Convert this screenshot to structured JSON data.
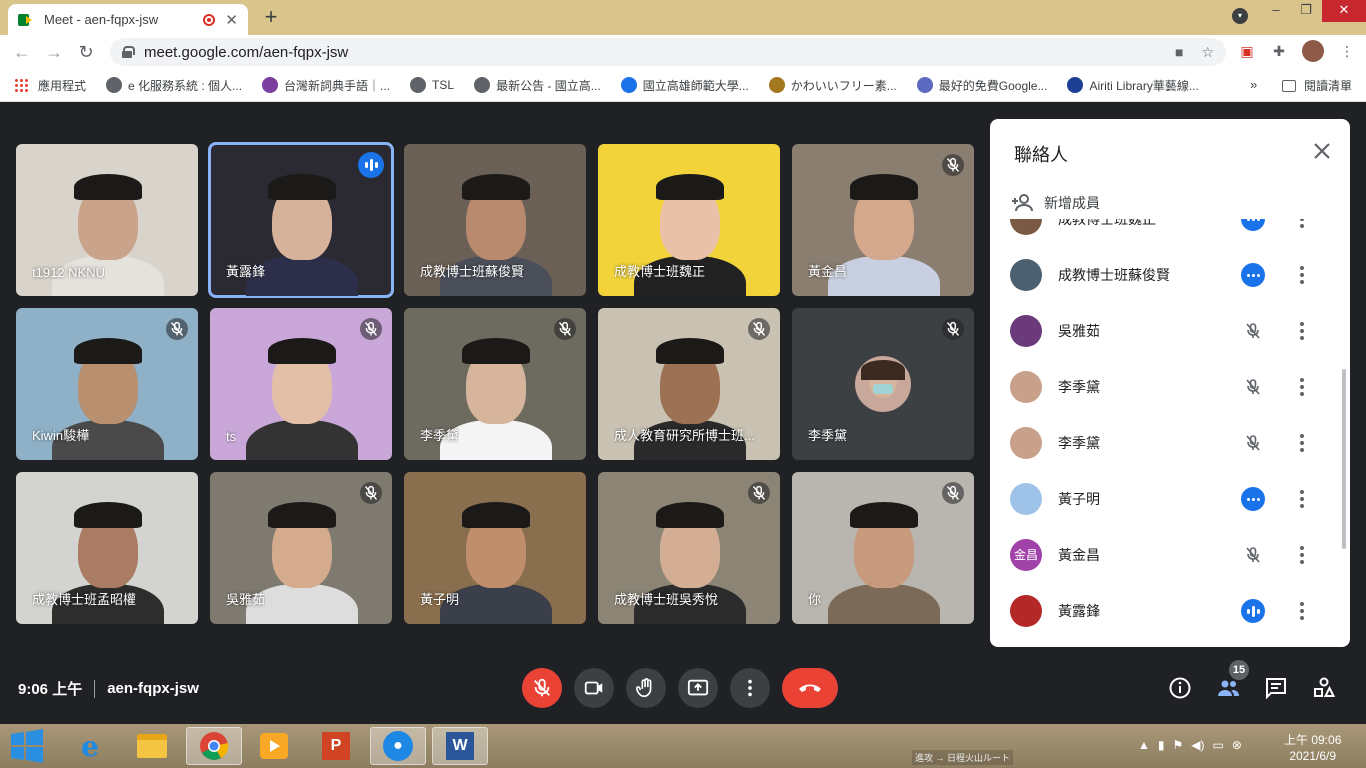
{
  "browser": {
    "tab_title": "Meet - aen-fqpx-jsw",
    "url": "meet.google.com/aen-fqpx-jsw",
    "window_controls": [
      "⌄",
      "–",
      "❐",
      "✕"
    ]
  },
  "bookmarks": {
    "items": [
      {
        "label": "應用程式",
        "icon": "apps-grid-icon",
        "color": "#ea4335"
      },
      {
        "label": "e 化服務系統 : 個人...",
        "icon": "globe-icon",
        "color": "#5f6368"
      },
      {
        "label": "台灣新詞典手語｜...",
        "icon": "site-icon",
        "color": "#7b3fa0"
      },
      {
        "label": "TSL",
        "icon": "globe-icon",
        "color": "#5f6368"
      },
      {
        "label": "最新公告 - 國立高...",
        "icon": "globe-icon",
        "color": "#5f6368"
      },
      {
        "label": "國立高雄師範大學...",
        "icon": "site-icon",
        "color": "#1a73e8"
      },
      {
        "label": "かわいいフリー素...",
        "icon": "site-icon",
        "color": "#a3781f"
      },
      {
        "label": "最好的免費Google...",
        "icon": "site-icon",
        "color": "#5c6bc0"
      },
      {
        "label": "Airiti Library華藝線...",
        "icon": "site-icon",
        "color": "#1c3f94"
      }
    ],
    "more": "»",
    "reading_list": "閱讀清單"
  },
  "tiles": [
    {
      "name": "t1912 NKNU",
      "muted": false,
      "talking": false,
      "bg": "#d8d4cc",
      "skin": "#c9a38a",
      "shirt": "#e5e2dc"
    },
    {
      "name": "黃露鋒",
      "muted": false,
      "talking": true,
      "active": true,
      "bg": "#2b2a33",
      "skin": "#d7b29a",
      "shirt": "#2d2f4a"
    },
    {
      "name": "成教博士班蘇俊賢",
      "muted": false,
      "talking": false,
      "bg": "#6b6055",
      "skin": "#b98a6e",
      "shirt": "#4b4f5a"
    },
    {
      "name": "成教博士班魏正",
      "muted": false,
      "talking": false,
      "bg": "#f2d43a",
      "skin": "#e8c1a8",
      "shirt": "#222"
    },
    {
      "name": "黃金昌",
      "muted": true,
      "talking": false,
      "bg": "#8a7e70",
      "skin": "#d3a88c",
      "shirt": "#c7cfe0"
    },
    {
      "name": "Kiwin駿樺",
      "muted": true,
      "talking": false,
      "bg": "#8fb1c7",
      "skin": "#b9906f",
      "shirt": "#4a4a4a"
    },
    {
      "name": "ts",
      "muted": true,
      "talking": false,
      "bg": "#c9a7d8",
      "skin": "#e3bfa7",
      "shirt": "#333"
    },
    {
      "name": "李季黛",
      "muted": true,
      "talking": false,
      "bg": "#6d6a60",
      "skin": "#d7b49c",
      "shirt": "#f4f4f4"
    },
    {
      "name": "成人教育研究所博士班...",
      "muted": true,
      "talking": false,
      "bg": "#c9c2b3",
      "skin": "#9d7154",
      "shirt": "#2a2a2a"
    },
    {
      "name": "李季黛",
      "muted": true,
      "talking": false,
      "avatar_only": true,
      "bg": "#3c4043",
      "skin": "#d7b49c",
      "shirt": "#ccc"
    },
    {
      "name": "成教博士班孟昭權",
      "muted": false,
      "talking": false,
      "bg": "#d3d3d0",
      "skin": "#a97c63",
      "shirt": "#2d2d2d"
    },
    {
      "name": "吳雅茹",
      "muted": true,
      "talking": false,
      "bg": "#7f7a70",
      "skin": "#d5ab8d",
      "shirt": "#ddd"
    },
    {
      "name": "黃子明",
      "muted": false,
      "talking": false,
      "bg": "#8a6f4e",
      "skin": "#c08e6c",
      "shirt": "#3b3f4a"
    },
    {
      "name": "成教博士班吳秀悅",
      "muted": true,
      "talking": false,
      "bg": "#8c8575",
      "skin": "#d4ae94",
      "shirt": "#2b2b2b"
    },
    {
      "name": "你",
      "muted": true,
      "talking": false,
      "bg": "#b8b6ae",
      "skin": "#c79a7d",
      "shirt": "#7b6a58"
    }
  ],
  "panel": {
    "title": "聯絡人",
    "add_member": "新增成員",
    "participants": [
      {
        "name": "成教博士班魏正",
        "status": "dots",
        "avatar_color": "#7a5a44",
        "partial": true
      },
      {
        "name": "成教博士班蘇俊賢",
        "status": "dots",
        "avatar_color": "#4b6070"
      },
      {
        "name": "吳雅茹",
        "status": "muted",
        "avatar_color": "#6a3a7a"
      },
      {
        "name": "李季黛",
        "status": "muted",
        "avatar_color": "#c9a08a"
      },
      {
        "name": "李季黛",
        "status": "muted",
        "avatar_color": "#c9a08a"
      },
      {
        "name": "黃子明",
        "status": "dots",
        "avatar_color": "#9fc3e8"
      },
      {
        "name": "黃金昌",
        "status": "muted",
        "avatar_color": "#a142a8",
        "initials": "金昌"
      },
      {
        "name": "黃露鋒",
        "status": "talking",
        "avatar_color": "#b52828"
      }
    ]
  },
  "controls": {
    "time": "9:06 上午",
    "meeting_code": "aen-fqpx-jsw",
    "participant_count": "15",
    "buttons": [
      "mic-off",
      "camera",
      "raise-hand",
      "present",
      "more",
      "hangup"
    ],
    "right_buttons": [
      "info",
      "people",
      "chat",
      "activities"
    ]
  },
  "taskbar": {
    "apps": [
      "start",
      "internet-explorer",
      "file-explorer",
      "chrome",
      "video-app",
      "powerpoint",
      "voice-recorder",
      "word"
    ],
    "clock_time": "上午 09:06",
    "clock_date": "2021/6/9",
    "wallpaper_label": "進攻 → 日程火山ルート"
  }
}
